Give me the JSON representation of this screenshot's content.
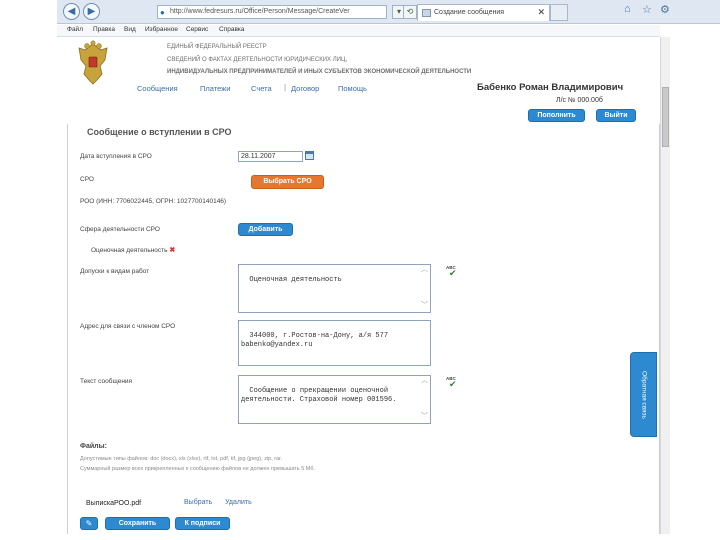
{
  "browser": {
    "address": "http://www.fedresurs.ru/Office/Person/Message/CreateVer",
    "tab_title": "Создание сообщения",
    "tab_close": "✕"
  },
  "menu": {
    "items": [
      "Файл",
      "Правка",
      "Вид",
      "Избранное",
      "Сервис",
      "Справка"
    ]
  },
  "header": {
    "org_lines": [
      "ЕДИНЫЙ ФЕДЕРАЛЬНЫЙ РЕЕСТР",
      "СВЕДЕНИЙ О ФАКТАХ ДЕЯТЕЛЬНОСТИ ЮРИДИЧЕСКИХ ЛИЦ,",
      "ИНДИВИДУАЛЬНЫХ ПРЕДПРИНИМАТЕЛЕЙ И ИНЫХ СУБЪЕКТОВ ЭКОНОМИЧЕСКОЙ ДЕЯТЕЛЬНОСТИ"
    ],
    "nav": [
      "Сообщения",
      "Платежи",
      "Счета",
      "Договор",
      "Помощь"
    ],
    "user_name": "Бабенко Роман Владимирович",
    "account": "Л/с № 000.00б",
    "topup_button": "Пополнить",
    "logout_button": "Выйти"
  },
  "form": {
    "title": "Сообщение о вступлении в СРО",
    "date_label": "Дата вступления в СРО",
    "date_value": "28.11.2007",
    "sro_label": "СРО",
    "choose_sro_button": "Выбрать СРО",
    "sro_value": "РОО (ИНН: 7706022445, ОГРН: 1027700140146)",
    "activity_label": "Сфера деятельности СРО",
    "add_button": "Добавить",
    "activity_item": "Оценочная деятельность",
    "activity_remove": "✖",
    "work_types_label": "Допуски к видам работ",
    "work_types_value": "Оценочная деятельность",
    "address_label": "Адрес для связи с членом СРО",
    "address_value": "344000, г.Ростов-на-Дону, а/я 577\nbabenko@yandex.ru",
    "message_label": "Текст сообщения",
    "message_value": "Сообщение о прекращении оценочной деятельности. Страховой номер 001596.",
    "spell_label": "ABC"
  },
  "files": {
    "title": "Файлы:",
    "note1": "Допустимые типы файлов: doc (docx), xls (xlsx), rtf, txt, pdf, tif, jpg (jpeg), zip, rar.",
    "note2": "Суммарный размер всех прикрепленных к сообщению файлов не должен превышать 5 Мб.",
    "file_name": "ВыпискаРОО.pdf",
    "choose_link": "Выбрать",
    "delete_link": "Удалить"
  },
  "actions": {
    "save_button": "Сохранить",
    "sign_button": "К подписи"
  },
  "feedback_tab": "Обратная связь",
  "colors": {
    "accent_blue": "#2d89d0",
    "accent_orange": "#e8772e",
    "link": "#3b6fa8"
  }
}
